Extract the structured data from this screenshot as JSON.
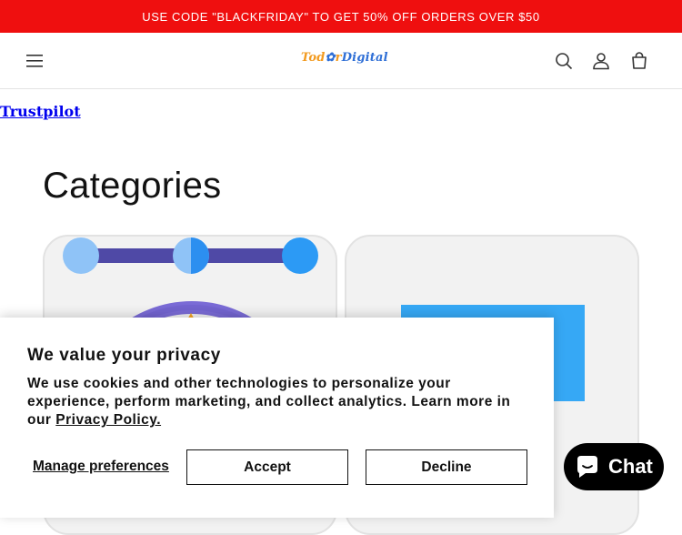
{
  "announcement": {
    "text": "USE CODE \"BLACKFRIDAY\" TO GET 50% OFF ORDERS OVER $50"
  },
  "header": {
    "logo_part1": "Tod",
    "logo_part2": "r",
    "logo_part3": "Digital",
    "icons": [
      "menu-icon",
      "search-icon",
      "account-icon",
      "cart-icon"
    ]
  },
  "trustpilot": {
    "label": "Trustpilot"
  },
  "categories": {
    "title": "Categories"
  },
  "cookie": {
    "title": "We value your privacy",
    "body": "We use cookies and other technologies to personalize your experience, perform marketing, and collect analytics. Learn more in our",
    "link": "Privacy Policy.",
    "manage": "Manage preferences",
    "accept": "Accept",
    "decline": "Decline"
  },
  "chat": {
    "label": "Chat"
  },
  "colors": {
    "announcement_bg": "#ef0f0f",
    "logo_orange": "#f29a1f",
    "logo_blue": "#2f6fd6",
    "chat_bg": "#000000"
  }
}
